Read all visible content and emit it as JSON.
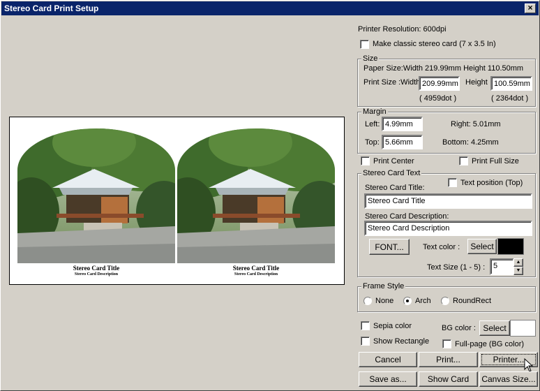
{
  "window": {
    "title": "Stereo Card Print Setup"
  },
  "printer_resolution": "Printer Resolution:   600dpi",
  "classic_card_label": "Make classic stereo card (7 x 3.5 In)",
  "size": {
    "legend": "Size",
    "paper_size": "Paper Size:Width 219.99mm Height 110.50mm",
    "print_size_label": "Print Size :Width",
    "width_value": "209.99mm",
    "height_label": "Height",
    "height_value": "100.59mm",
    "width_dots": "( 4959dot )",
    "height_dots": "( 2364dot )"
  },
  "margin": {
    "legend": "Margin",
    "left_label": "Left:",
    "left_value": "4.99mm",
    "top_label": "Top:",
    "top_value": "5.66mm",
    "right_text": "Right:  5.01mm",
    "bottom_text": "Bottom:   4.25mm"
  },
  "print_center_label": "Print Center",
  "print_full_size_label": "Print Full Size",
  "card_text": {
    "legend": "Stereo Card Text",
    "text_position_label": "Text position (Top)",
    "title_label": "Stereo Card Title:",
    "title_value": "Stereo Card Title",
    "desc_label": "Stereo Card Description:",
    "desc_value": "Stereo Card Description",
    "font_button": "FONT...",
    "text_color_label": "Text color :",
    "select_button": "Select",
    "text_color": "#000000",
    "text_size_label": "Text Size (1 - 5) :",
    "text_size_value": "5"
  },
  "frame_style": {
    "legend": "Frame Style",
    "options": [
      "None",
      "Arch",
      "RoundRect"
    ],
    "selected": "Arch"
  },
  "sepia_label": "Sepia color",
  "show_rect_label": "Show Rectangle",
  "bg_color_label": "BG color :",
  "bg_select_button": "Select",
  "bg_color": "#ffffff",
  "full_page_label": "Full-page (BG color)",
  "buttons": {
    "cancel": "Cancel",
    "print": "Print...",
    "printer": "Printer...",
    "save_as": "Save as...",
    "show_card": "Show Card",
    "canvas_size": "Canvas Size..."
  },
  "preview": {
    "caption_title": "Stereo Card Title",
    "caption_desc": "Stereo Card Description"
  }
}
